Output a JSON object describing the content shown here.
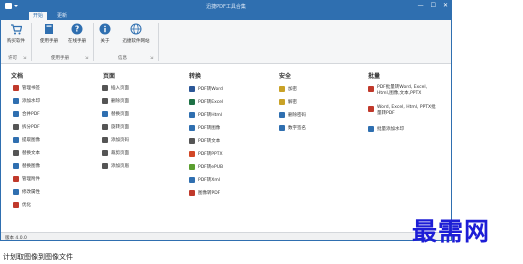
{
  "window": {
    "title": "迅捷PDF工具合集",
    "min": "—",
    "max": "☐",
    "close": "✕"
  },
  "tabs": [
    {
      "label": "开始",
      "active": true
    },
    {
      "label": "更新",
      "active": false
    }
  ],
  "ribbon": {
    "buttons": [
      {
        "label": "购买软件",
        "icon": "cart-icon"
      },
      {
        "label": "使用手册",
        "icon": "manual-icon"
      },
      {
        "label": "在线手册",
        "icon": "help-icon"
      },
      {
        "label": "关于",
        "icon": "info-icon"
      },
      {
        "label": "迅捷软件网站",
        "icon": "globe-icon"
      }
    ],
    "groups": [
      {
        "label": "许可"
      },
      {
        "label": "使用手册"
      },
      {
        "label": "信息"
      }
    ],
    "launcher": "⇲"
  },
  "columns": {
    "document": {
      "heading": "文档",
      "items": [
        {
          "label": "管理书签",
          "color": "#c0392b"
        },
        {
          "label": "添加水印",
          "color": "#2f6fb0"
        },
        {
          "label": "合并PDF",
          "color": "#2f6fb0"
        },
        {
          "label": "拆分PDF",
          "color": "#555555"
        },
        {
          "label": "提取图像",
          "color": "#2f6fb0"
        },
        {
          "label": "替换文本",
          "color": "#555555"
        },
        {
          "label": "替换图像",
          "color": "#2f6fb0"
        },
        {
          "label": "管理附件",
          "color": "#c0392b"
        },
        {
          "label": "修改属性",
          "color": "#2f6fb0"
        },
        {
          "label": "优化",
          "color": "#c0392b"
        }
      ]
    },
    "page": {
      "heading": "页面",
      "items": [
        {
          "label": "插入页面",
          "color": "#555555"
        },
        {
          "label": "删除页面",
          "color": "#555555"
        },
        {
          "label": "替换页面",
          "color": "#2f6fb0"
        },
        {
          "label": "旋转页面",
          "color": "#555555"
        },
        {
          "label": "添加页码",
          "color": "#555555"
        },
        {
          "label": "裁剪页面",
          "color": "#555555"
        },
        {
          "label": "添加页眉",
          "color": "#555555"
        }
      ]
    },
    "convert": {
      "heading": "转换",
      "items": [
        {
          "label": "PDF转Word",
          "color": "#2b5797"
        },
        {
          "label": "PDF转Excel",
          "color": "#1e7145"
        },
        {
          "label": "PDF转Html",
          "color": "#2f6fb0"
        },
        {
          "label": "PDF转图像",
          "color": "#2f6fb0"
        },
        {
          "label": "PDF转文本",
          "color": "#555555"
        },
        {
          "label": "PDF转PPTX",
          "color": "#d24726"
        },
        {
          "label": "PDF转ePUB",
          "color": "#5a9e2f"
        },
        {
          "label": "PDF转Xml",
          "color": "#2f6fb0"
        },
        {
          "label": "图像转PDF",
          "color": "#c0392b"
        }
      ]
    },
    "security": {
      "heading": "安全",
      "items": [
        {
          "label": "加密",
          "color": "#c9a227"
        },
        {
          "label": "解密",
          "color": "#c9a227"
        },
        {
          "label": "删除密码",
          "color": "#2f6fb0"
        },
        {
          "label": "数字签名",
          "color": "#2f6fb0"
        }
      ]
    },
    "batch": {
      "heading": "批量",
      "items": [
        {
          "line1": "PDF批量转Word, Excel,",
          "line2": "Html,图像,文本,PPTX",
          "color": "#c0392b"
        },
        {
          "line1": "Word, Excel, Html, PPTX批",
          "line2": "量转PDF",
          "color": "#c0392b"
        },
        {
          "line1": "批量添加水印",
          "line2": "",
          "color": "#2f6fb0"
        }
      ]
    }
  },
  "status": {
    "version": "版本 4.0.0"
  },
  "caption": "计划取图像到图像文件",
  "watermark": "最需网"
}
